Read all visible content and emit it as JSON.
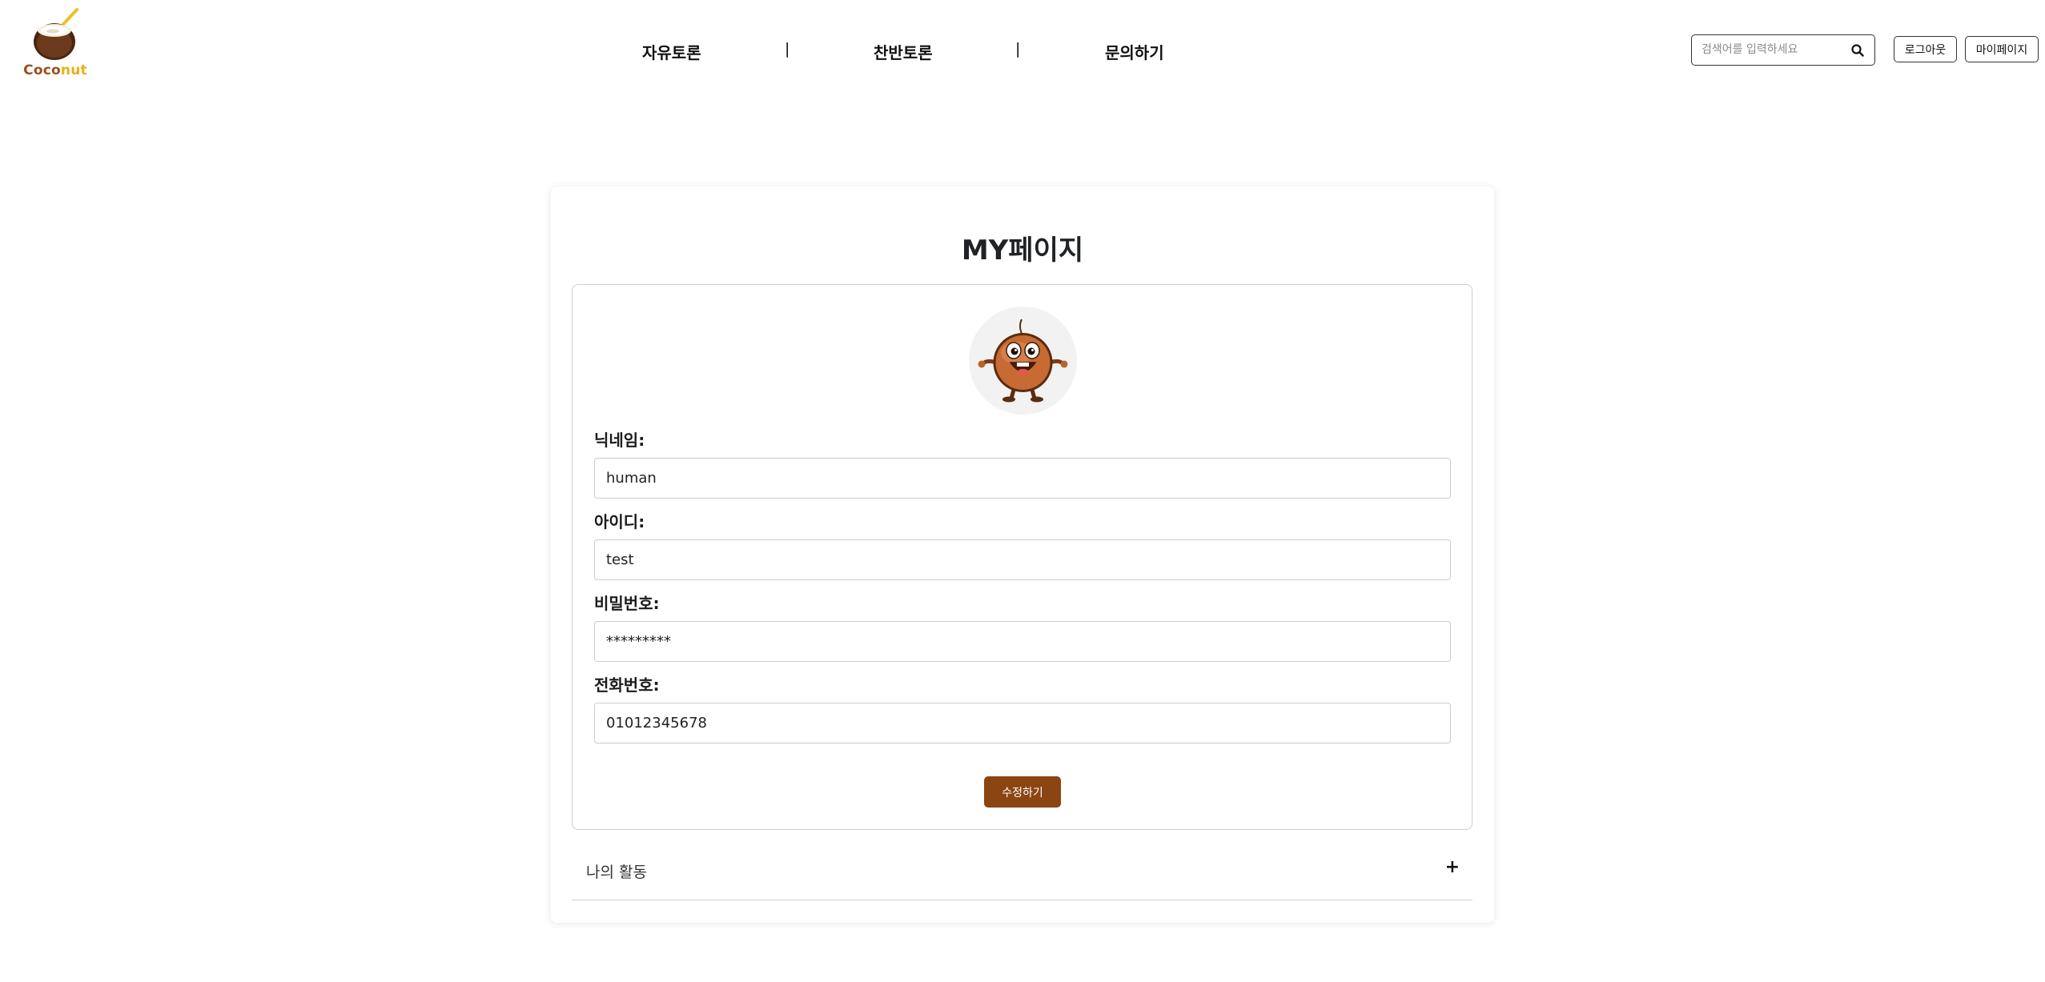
{
  "brand": {
    "logo_prefix": "Coco",
    "logo_suffix": "nut",
    "colors": {
      "prefix": "#9b4f1c",
      "suffix": "#e8b016"
    }
  },
  "nav": {
    "items": [
      {
        "label": "자유토론"
      },
      {
        "label": "찬반토론"
      },
      {
        "label": "문의하기"
      }
    ],
    "separator": "|"
  },
  "search": {
    "placeholder": "검색어를 입력하세요",
    "value": "",
    "icon": "search-icon"
  },
  "header_buttons": {
    "logout": "로그아웃",
    "mypage": "마이페이지"
  },
  "page": {
    "title": "MY페이지"
  },
  "profile": {
    "avatar_icon": "coconut-character",
    "fields": {
      "nickname": {
        "label": "닉네임:",
        "value": "human"
      },
      "user_id": {
        "label": "아이디:",
        "value": "test"
      },
      "password": {
        "label": "비밀번호:",
        "value": "*********"
      },
      "phone": {
        "label": "전화번호:",
        "value": "01012345678"
      }
    },
    "edit_button": "수정하기"
  },
  "activity": {
    "label": "나의 활동",
    "toggle": "+"
  },
  "colors": {
    "accent": "#8b4513",
    "border": "#cfcfcf"
  }
}
